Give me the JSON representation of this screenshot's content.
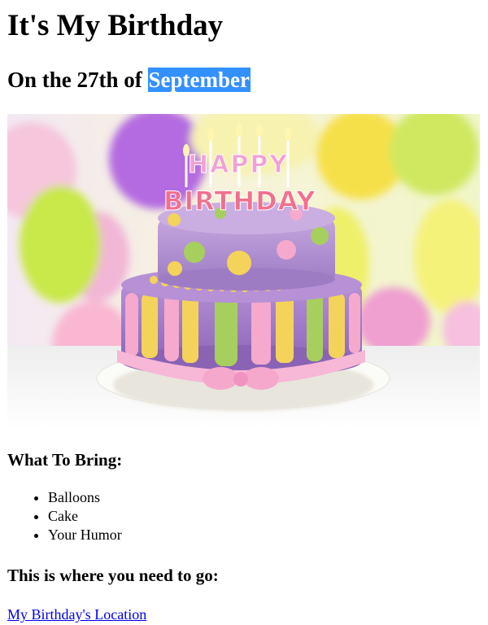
{
  "page": {
    "title": "It's My Birthday",
    "subtitle_prefix": "On the 27th of",
    "subtitle_highlight": "September"
  },
  "image": {
    "topper_line1": "HAPPY",
    "topper_line2": "BIRTHDAY"
  },
  "bring": {
    "heading": "What To Bring:",
    "items": [
      "Balloons",
      "Cake",
      "Your Humor"
    ]
  },
  "location": {
    "heading": "This is where you need to go:",
    "link_text": "My Birthday's Location"
  },
  "colors": {
    "selection_highlight": "#3390ff",
    "link": "#0000ee"
  }
}
